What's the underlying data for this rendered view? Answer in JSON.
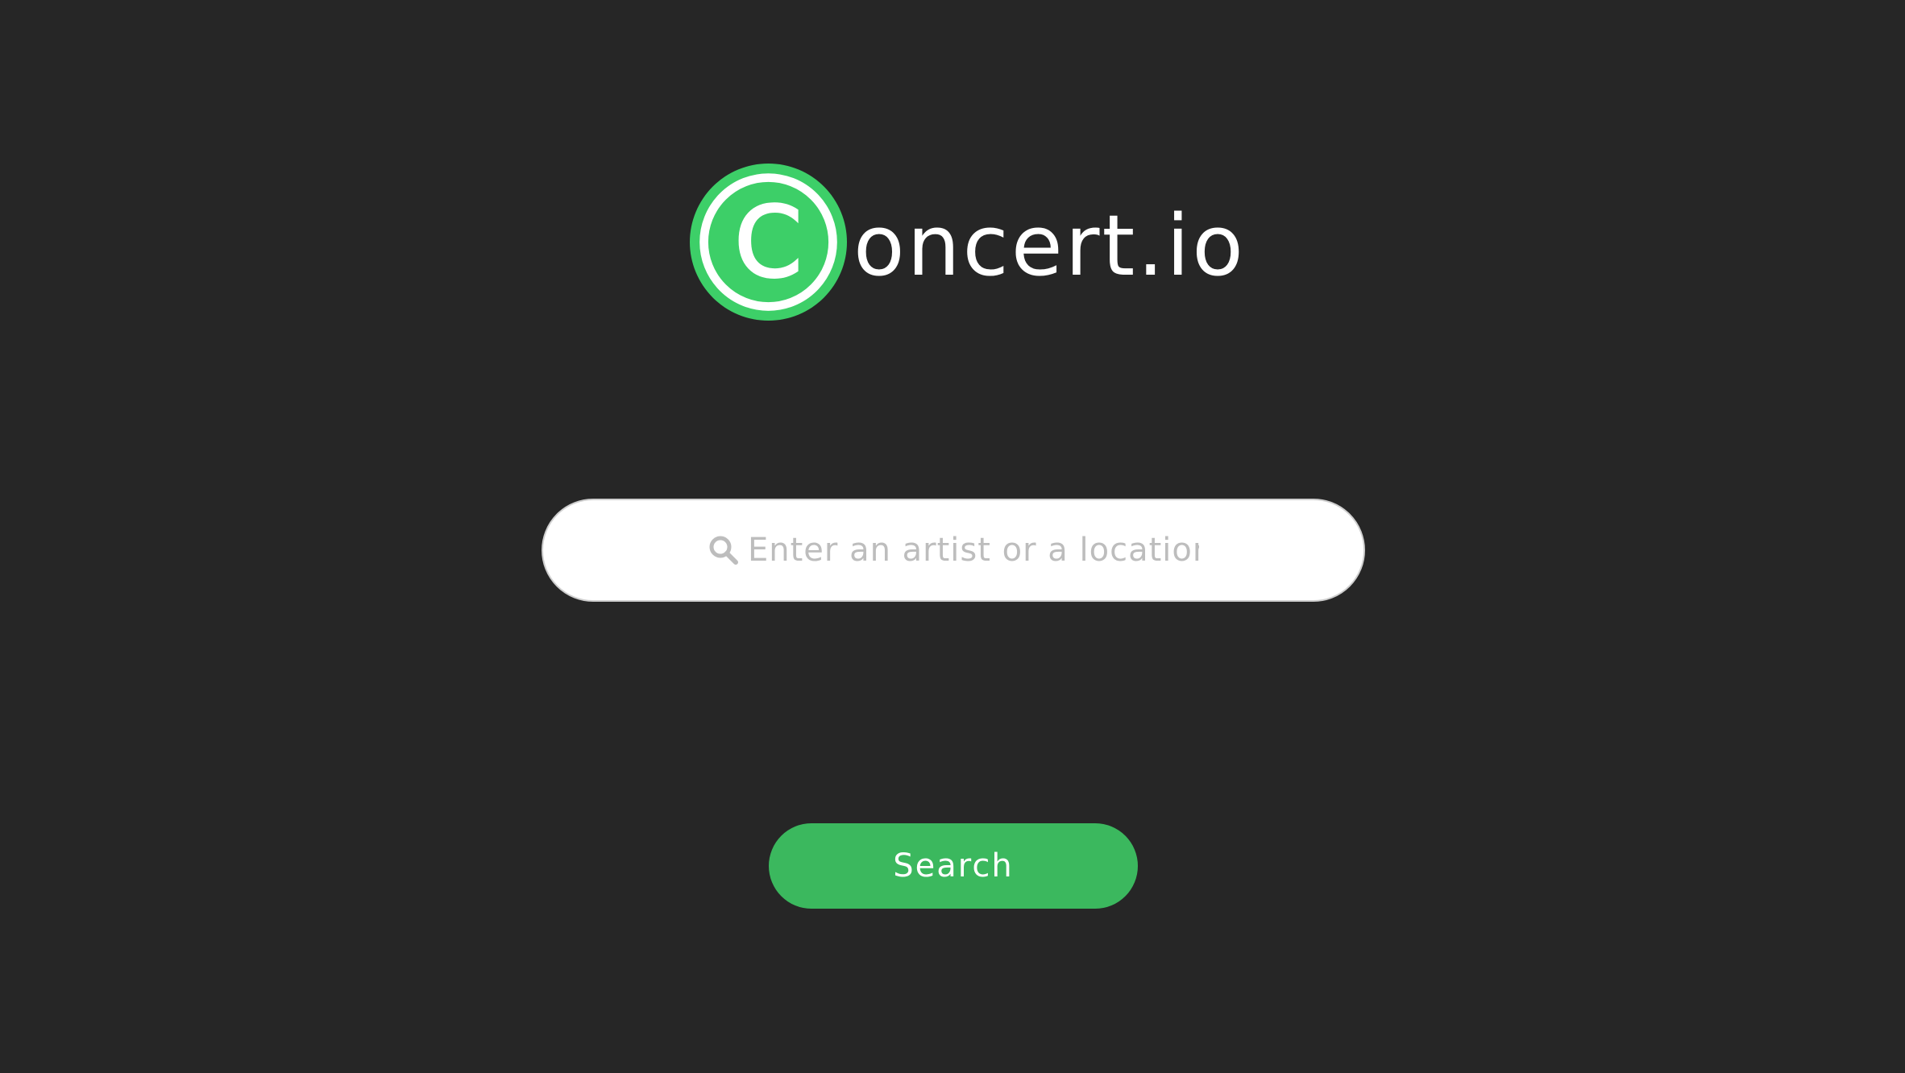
{
  "brand": {
    "name_rest": "oncert.io",
    "logo_letter": "C",
    "logo_icon": "concert-logo-icon",
    "colors": {
      "background": "#262626",
      "logo_ring": "#3dcf68",
      "button": "#3bb85e"
    }
  },
  "search": {
    "icon": "search-icon",
    "placeholder": "Enter an artist or a location!",
    "value": ""
  },
  "actions": {
    "search_label": "Search"
  }
}
